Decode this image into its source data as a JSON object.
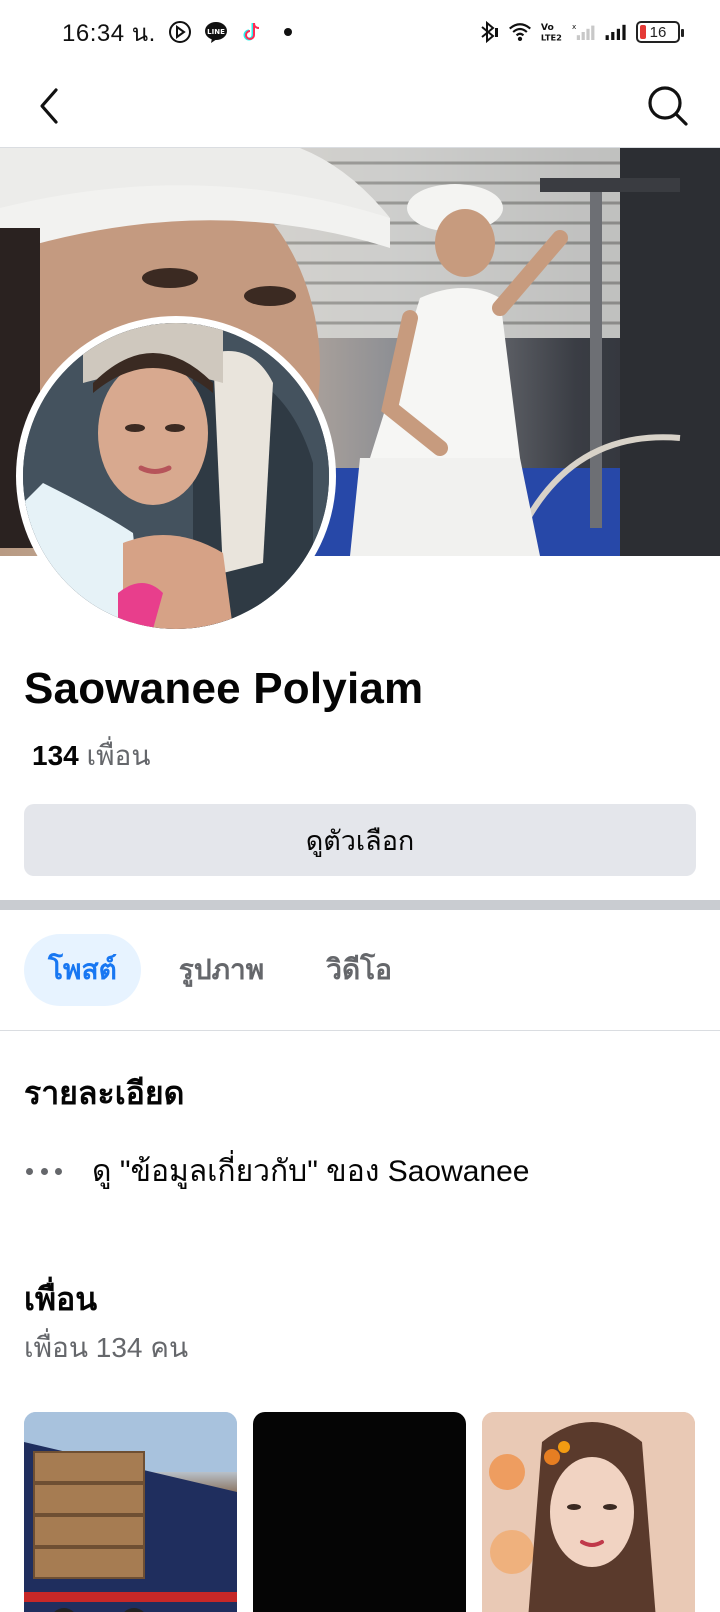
{
  "status_bar": {
    "time": "16:34 น.",
    "battery_level": "16",
    "icons": [
      "direction-icon",
      "line-app-icon",
      "tiktok-icon",
      "dot-icon",
      "bluetooth-icon",
      "wifi-icon",
      "volte-icon",
      "signal-icon",
      "battery-icon"
    ]
  },
  "nav": {
    "back_icon": "chevron-left-icon",
    "search_icon": "search-icon"
  },
  "profile": {
    "name": "Saowanee Polyiam",
    "friends_number": "134",
    "friends_word": "เพื่อน",
    "options_label": "ดูตัวเลือก"
  },
  "tabs": [
    {
      "label": "โพสต์",
      "active": true
    },
    {
      "label": "รูปภาพ",
      "active": false
    },
    {
      "label": "วิดีโอ",
      "active": false
    }
  ],
  "details": {
    "title": "รายละเอียด",
    "about_text": "ดู \"ข้อมูลเกี่ยวกับ\" ของ Saowanee"
  },
  "friends_section": {
    "title": "เพื่อน",
    "count_text": "เพื่อน 134 คน"
  },
  "colors": {
    "accent": "#1877f2",
    "accent_bg": "#e7f3ff",
    "secondary_text": "#65676b",
    "button_bg": "#e4e6eb",
    "battery_low": "#e53935"
  }
}
